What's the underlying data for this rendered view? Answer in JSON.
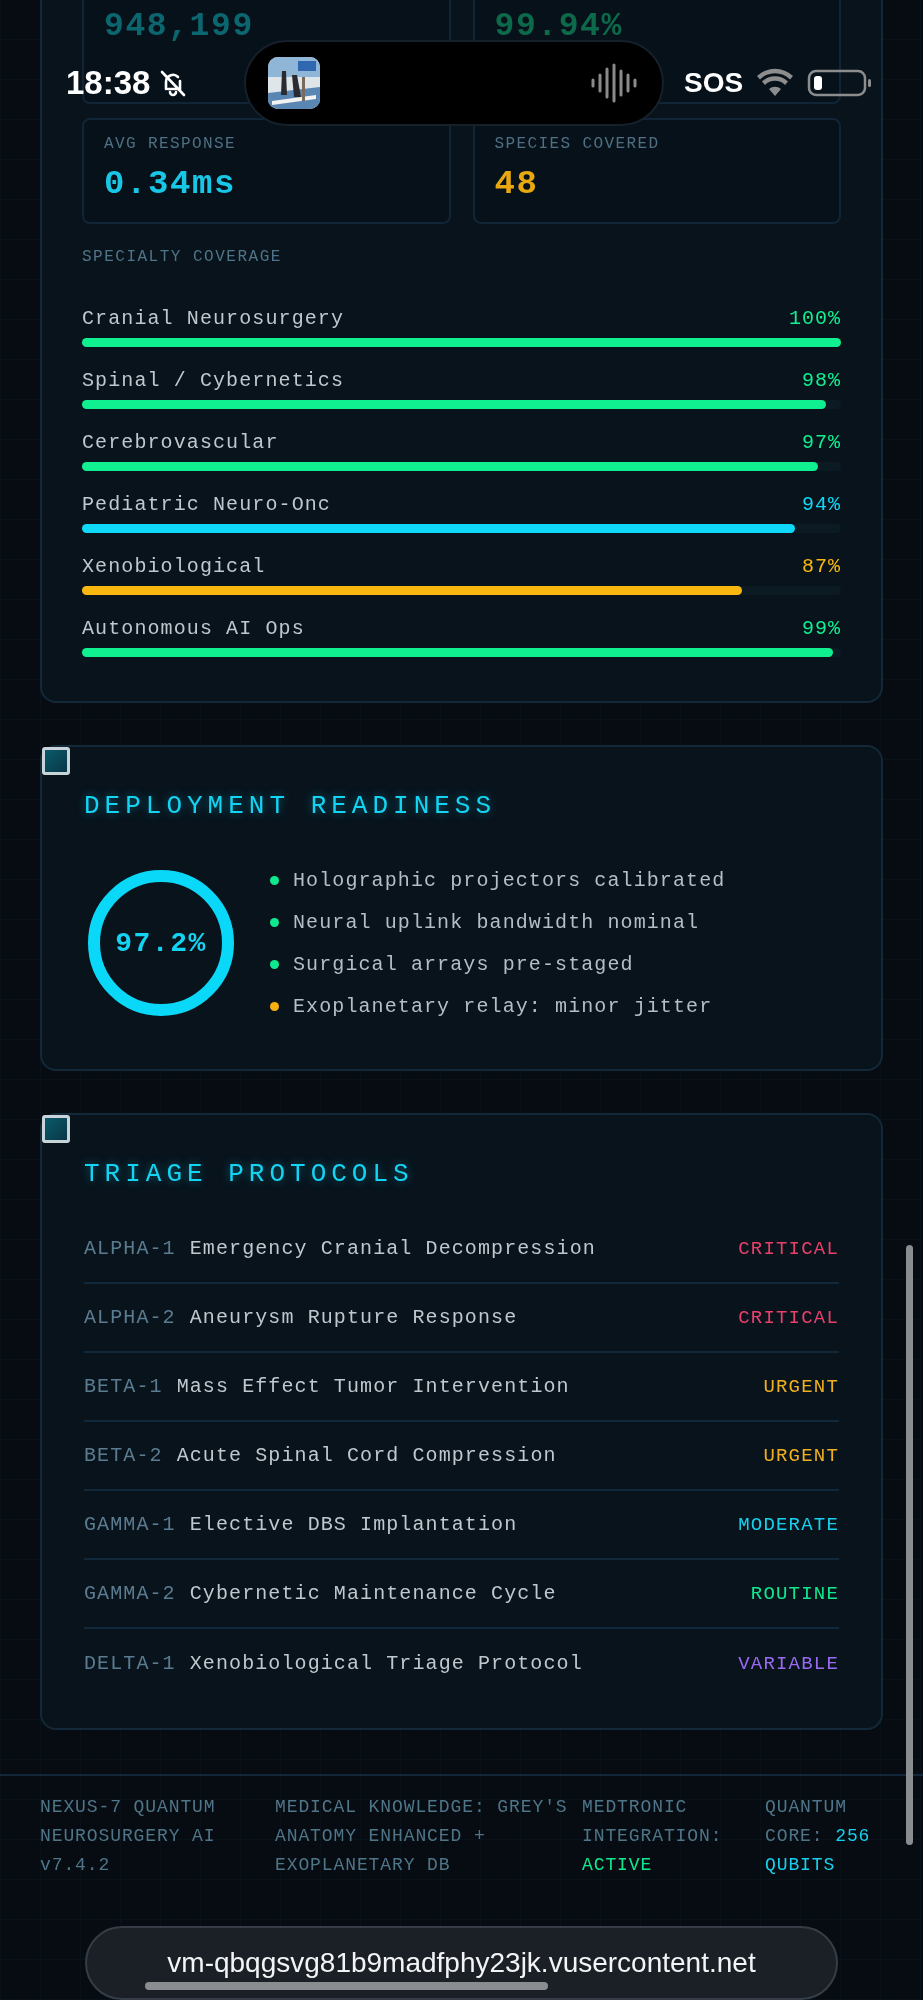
{
  "status_bar": {
    "time": "18:38",
    "sos": "SOS"
  },
  "stats": [
    {
      "value": "948,199",
      "color": "#0c6670"
    },
    {
      "value": "99.94%",
      "color": "#0c6a4a"
    },
    {
      "label": "AVG RESPONSE",
      "value": "0.34ms",
      "color": "#18c6e6"
    },
    {
      "label": "SPECIES COVERED",
      "value": "48",
      "color": "#e8a810"
    }
  ],
  "specialty": {
    "title": "SPECIALTY COVERAGE",
    "rows": [
      {
        "label": "Cranial Neurosurgery",
        "percent": "100%",
        "level": 1.0,
        "color": "#10f090"
      },
      {
        "label": "Spinal / Cybernetics",
        "percent": "98%",
        "level": 0.98,
        "color": "#10f090"
      },
      {
        "label": "Cerebrovascular",
        "percent": "97%",
        "level": 0.97,
        "color": "#10f090"
      },
      {
        "label": "Pediatric Neuro-Onc",
        "percent": "94%",
        "level": 0.94,
        "color": "#10d8f8"
      },
      {
        "label": "Xenobiological",
        "percent": "87%",
        "level": 0.87,
        "color": "#f8b810"
      },
      {
        "label": "Autonomous AI Ops",
        "percent": "99%",
        "level": 0.99,
        "color": "#10f090"
      }
    ]
  },
  "readiness": {
    "title": "DEPLOYMENT READINESS",
    "value": "97.2%",
    "items": [
      {
        "text": "Holographic projectors calibrated",
        "color": "#10e890"
      },
      {
        "text": "Neural uplink bandwidth nominal",
        "color": "#10e890"
      },
      {
        "text": "Surgical arrays pre-staged",
        "color": "#10e890"
      },
      {
        "text": "Exoplanetary relay: minor jitter",
        "color": "#f8b010"
      }
    ]
  },
  "triage": {
    "title": "TRIAGE PROTOCOLS",
    "rows": [
      {
        "code": "ALPHA-1",
        "name": "Emergency Cranial Decompression",
        "priority": "CRITICAL",
        "color": "#e8406a"
      },
      {
        "code": "ALPHA-2",
        "name": "Aneurysm Rupture Response",
        "priority": "CRITICAL",
        "color": "#e8406a"
      },
      {
        "code": "BETA-1",
        "name": "Mass Effect Tumor Intervention",
        "priority": "URGENT",
        "color": "#f0b020"
      },
      {
        "code": "BETA-2",
        "name": "Acute Spinal Cord Compression",
        "priority": "URGENT",
        "color": "#f0b020"
      },
      {
        "code": "GAMMA-1",
        "name": "Elective DBS Implantation",
        "priority": "MODERATE",
        "color": "#18d0ee"
      },
      {
        "code": "GAMMA-2",
        "name": "Cybernetic Maintenance Cycle",
        "priority": "ROUTINE",
        "color": "#10e890"
      },
      {
        "code": "DELTA-1",
        "name": "Xenobiological Triage Protocol",
        "priority": "VARIABLE",
        "color": "#9a6af0"
      }
    ]
  },
  "footer": [
    {
      "text": "NEXUS-7 QUANTUM NEUROSURGERY AI v7.4.2"
    },
    {
      "text": "MEDICAL KNOWLEDGE: GREY'S ANATOMY ENHANCED + EXOPLANETARY DB"
    },
    {
      "text": "MEDTRONIC INTEGRATION:",
      "value": "ACTIVE",
      "color": "#10e890"
    },
    {
      "text": "QUANTUM CORE:",
      "value": "256 QUBITS",
      "color": "#18d0ee"
    }
  ],
  "url": "vm-qbqgsvg81b9madfphy23jk.vusercontent.net"
}
